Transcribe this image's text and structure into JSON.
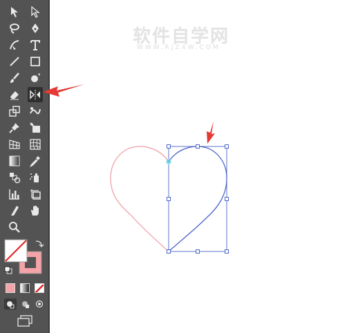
{
  "watermark": {
    "main": "软件自学网",
    "sub": "WWW.RJZXW.COM"
  },
  "colors": {
    "toolbar_bg": "#535353",
    "selection_blue": "#4a64c8",
    "heart_pink": "#f0a0a8",
    "arrow_red": "#e53935",
    "fill_swatch": "#f4a3a8"
  },
  "toolbar": {
    "tools": [
      "selection-tool",
      "direct-selection-tool",
      "lasso-tool",
      "pen-tool",
      "curvature-tool",
      "type-tool",
      "line-tool",
      "rectangle-tool",
      "paintbrush-tool",
      "blob-brush-tool",
      "eraser-tool",
      "reflect-tool",
      "scale-tool",
      "puppet-warp-tool",
      "pin-tool",
      "shape-builder-tool",
      "perspective-grid-tool",
      "mesh-tool",
      "gradient-tool",
      "eyedropper-tool",
      "blend-tool",
      "symbol-sprayer-tool",
      "column-graph-tool",
      "artboard-tool",
      "slice-tool",
      "hand-tool",
      "zoom-tool"
    ],
    "active_tool": "reflect-tool"
  }
}
